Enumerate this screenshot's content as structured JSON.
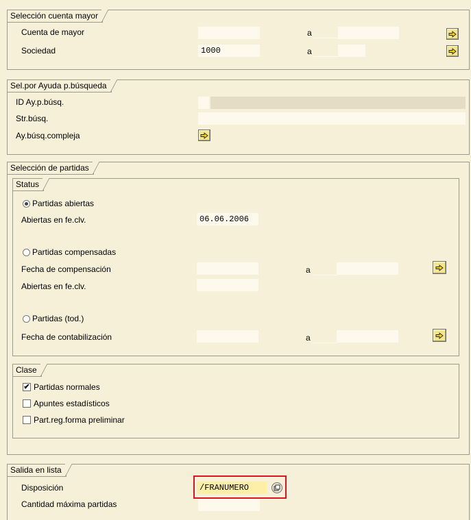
{
  "sec_cuenta": {
    "title": "Selección cuenta mayor",
    "row1_label": "Cuenta de mayor",
    "row1_from": "",
    "row1_to": "",
    "row2_label": "Sociedad",
    "row2_from": "1000",
    "row2_to": "",
    "to_label": "a"
  },
  "sec_ayuda": {
    "title": "Sel.por Ayuda p.búsqueda",
    "id_label": "ID Ay.p.búsq.",
    "id_value": "",
    "str_label": "Str.búsq.",
    "str_value": "",
    "compleja_label": "Ay.búsq.compleja"
  },
  "sec_partidas": {
    "title": "Selección de partidas",
    "status": {
      "title": "Status",
      "abiertas_label": "Partidas abiertas",
      "abiertas_selected": true,
      "abiertas_fecha_label": "Abiertas en fe.clv.",
      "abiertas_fecha_value": "06.06.2006",
      "compensadas_label": "Partidas compensadas",
      "fecha_comp_label": "Fecha de compensación",
      "fecha_comp_from": "",
      "fecha_comp_to": "",
      "abiertas2_label": "Abiertas en fe.clv.",
      "abiertas2_value": "",
      "todas_label": "Partidas (tod.)",
      "fecha_cont_label": "Fecha de contabilización",
      "fecha_cont_from": "",
      "fecha_cont_to": "",
      "to_label": "a"
    },
    "clase": {
      "title": "Clase",
      "items": [
        {
          "label": "Partidas normales",
          "checked": true
        },
        {
          "label": "Apuntes estadísticos",
          "checked": false
        },
        {
          "label": "Part.reg.forma preliminar",
          "checked": false
        }
      ]
    }
  },
  "sec_salida": {
    "title": "Salida en lista",
    "disposicion_label": "Disposición",
    "disposicion_value": "/FRANUMERO",
    "cantidad_label": "Cantidad máxima partidas",
    "cantidad_value": ""
  },
  "colors": {
    "background": "#f6f0d8",
    "field": "#fdf9ec",
    "button": "#f4e68e",
    "highlight": "#e0141e"
  },
  "icons": {
    "multi_select": "arrow-right-icon",
    "layout_choose": "choose-layout-icon"
  }
}
